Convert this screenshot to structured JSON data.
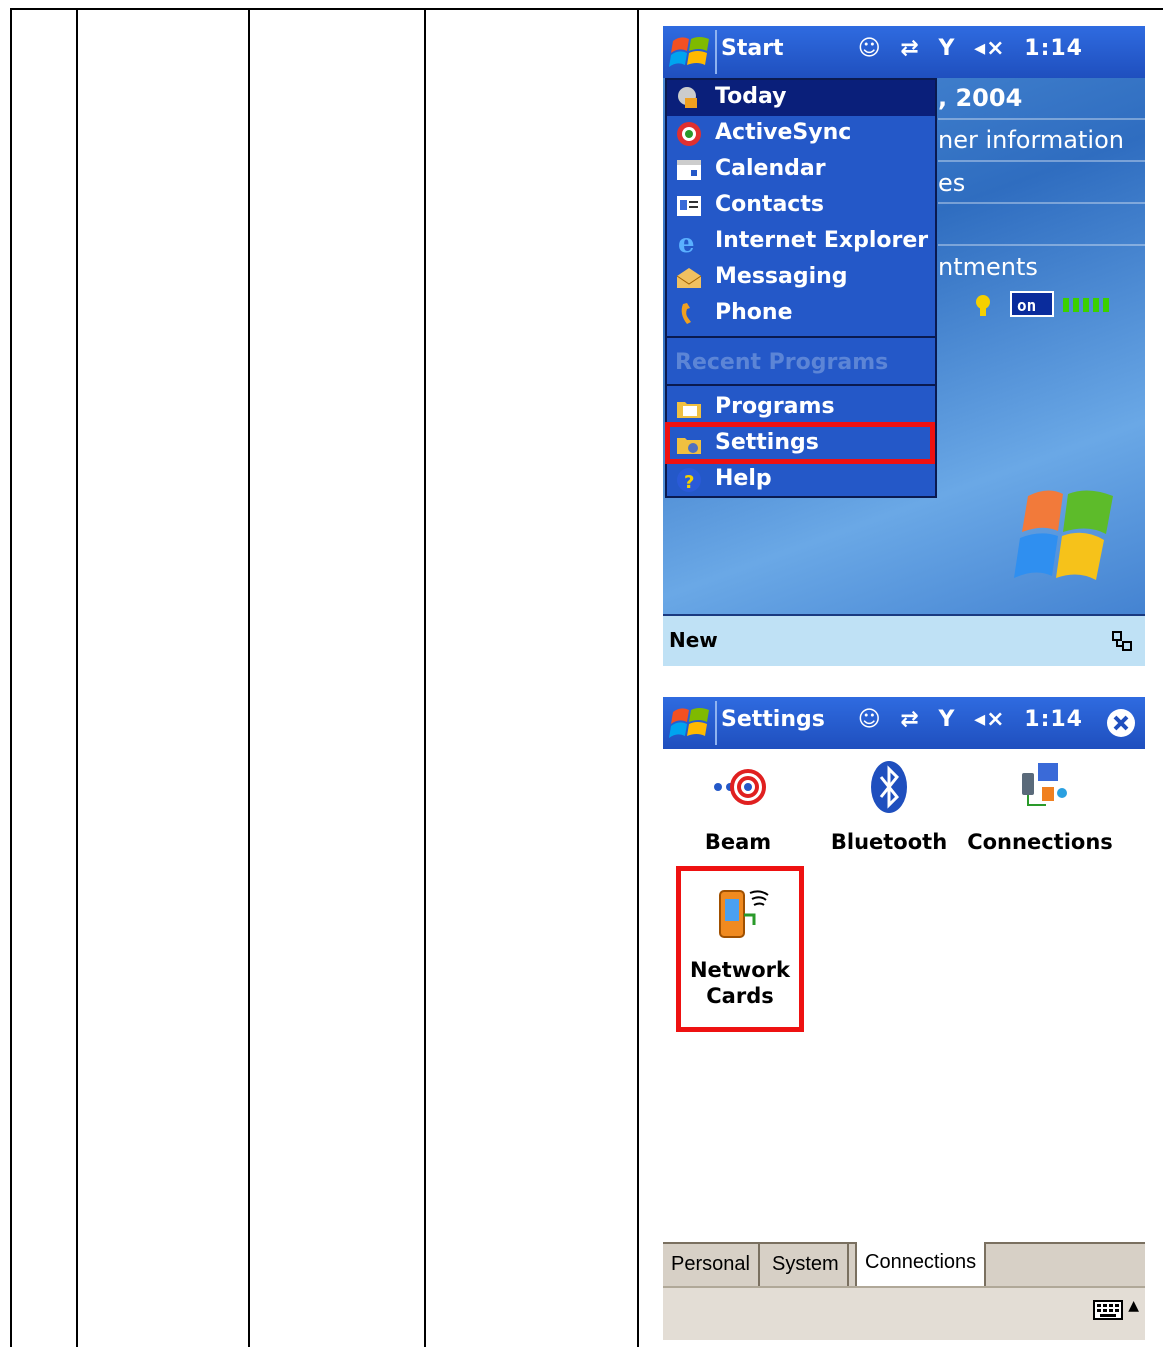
{
  "start_screen": {
    "title": "Start",
    "status_icons": [
      "message-icon",
      "connectivity-icon",
      "signal-icon",
      "volume-muted-icon"
    ],
    "time": "1:14",
    "today_background": {
      "date": ", 2004",
      "owner": "ner information",
      "messages": "es",
      "appointments": "ntments"
    },
    "menu": {
      "items": [
        {
          "label": "Today",
          "icon": "today-icon"
        },
        {
          "label": "ActiveSync",
          "icon": "activesync-icon"
        },
        {
          "label": "Calendar",
          "icon": "calendar-icon"
        },
        {
          "label": "Contacts",
          "icon": "contacts-icon"
        },
        {
          "label": "Internet Explorer",
          "icon": "internet-explorer-icon"
        },
        {
          "label": "Messaging",
          "icon": "messaging-icon"
        },
        {
          "label": "Phone",
          "icon": "phone-icon"
        }
      ],
      "recent_header": "Recent Programs",
      "bottom_items": [
        {
          "label": "Programs",
          "icon": "programs-folder-icon"
        },
        {
          "label": "Settings",
          "icon": "settings-folder-icon"
        },
        {
          "label": "Help",
          "icon": "help-icon"
        }
      ]
    },
    "softkey_left": "New"
  },
  "settings_screen": {
    "title": "Settings",
    "time": "1:14",
    "icons": [
      {
        "label": "Beam",
        "icon": "beam-icon"
      },
      {
        "label": "Bluetooth",
        "icon": "bluetooth-icon"
      },
      {
        "label": "Connections",
        "icon": "connections-icon"
      }
    ],
    "network_cards": {
      "line1": "Network",
      "line2": "Cards"
    },
    "tabs": [
      "Personal",
      "System",
      "Connections"
    ],
    "active_tab": "Connections"
  },
  "colors": {
    "highlight": "#ee1111",
    "title_bar": "#2458c8"
  }
}
